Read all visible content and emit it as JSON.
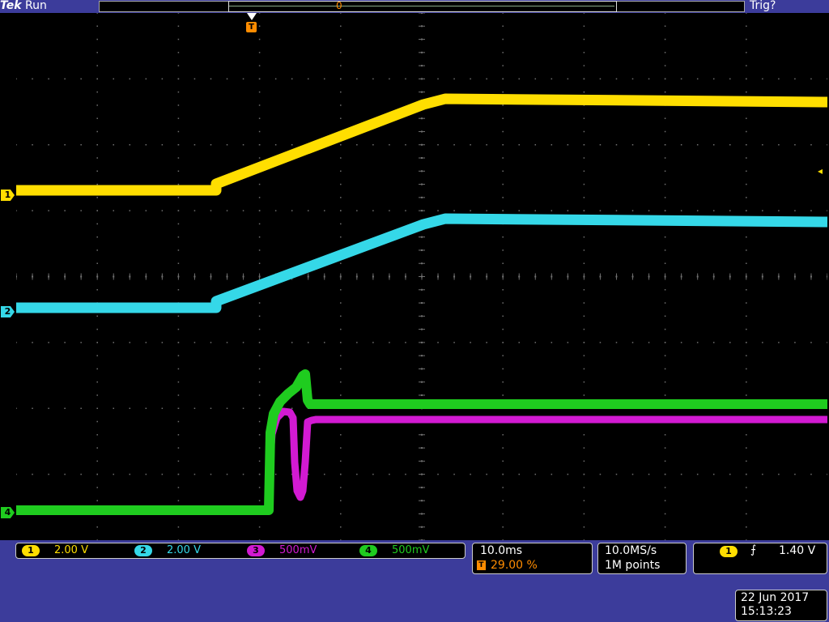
{
  "header": {
    "brand": "Tek",
    "run_state": "Run",
    "trigger_status": "Trig?",
    "record_marker": "0"
  },
  "screen": {
    "trigger_position_badge": "T",
    "channel_markers": [
      {
        "label": "1",
        "color": "#ffde00"
      },
      {
        "label": "2",
        "color": "#35d8e8"
      },
      {
        "label": "4",
        "color": "#1fcc1f"
      }
    ],
    "trigger_level_arrow": "◂"
  },
  "colors": {
    "ch1": "#ffde00",
    "ch2": "#35d8e8",
    "ch3": "#d21ad2",
    "ch4": "#1fcc1f",
    "grid": "#707070",
    "background": "#000000",
    "frame": "#3c3c9b",
    "accent_orange": "#ff8c00"
  },
  "channels": [
    {
      "number": "1",
      "scale": "2.00 V",
      "color": "#ffde00"
    },
    {
      "number": "2",
      "scale": "2.00 V",
      "color": "#35d8e8"
    },
    {
      "number": "3",
      "scale": "500mV",
      "color": "#d21ad2"
    },
    {
      "number": "4",
      "scale": "500mV",
      "color": "#1fcc1f"
    }
  ],
  "horizontal": {
    "scale": "10.0ms",
    "position_badge": "T",
    "position": "29.00 %"
  },
  "acquisition": {
    "sample_rate": "10.0MS/s",
    "record_length": "1M points"
  },
  "trigger": {
    "source": "1",
    "slope_icon": "rising-edge-icon",
    "slope_glyph": "⨍",
    "level": "1.40 V"
  },
  "datetime": {
    "date": "22 Jun 2017",
    "time": "15:13:23"
  }
}
